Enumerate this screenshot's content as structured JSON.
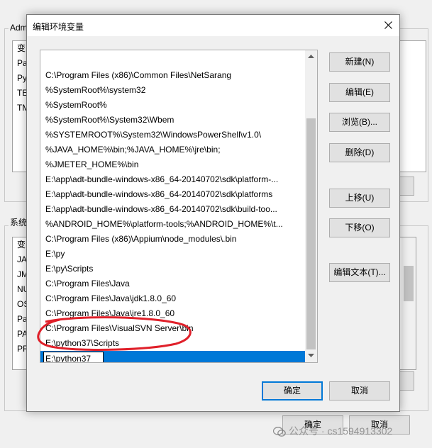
{
  "background_window": {
    "user_group_label": "Adm",
    "user_vars": [
      "变",
      "Pa",
      "Py",
      "TE",
      "TM"
    ],
    "system_group_label": "系统",
    "system_vars": [
      "变",
      "JA",
      "JM",
      "NU",
      "OS",
      "Pa",
      "PA",
      "PR"
    ],
    "ok_label": "确定",
    "cancel_label": "取消"
  },
  "dialog": {
    "title": "编辑环境变量",
    "entries": [
      "C:\\Program Files (x86)\\Common Files\\NetSarang",
      "%SystemRoot%\\system32",
      "%SystemRoot%",
      "%SystemRoot%\\System32\\Wbem",
      "%SYSTEMROOT%\\System32\\WindowsPowerShell\\v1.0\\",
      "%JAVA_HOME%\\bin;%JAVA_HOME%\\jre\\bin;",
      "%JMETER_HOME%\\bin",
      "E:\\app\\adt-bundle-windows-x86_64-20140702\\sdk\\platform-...",
      "E:\\app\\adt-bundle-windows-x86_64-20140702\\sdk\\platforms",
      "E:\\app\\adt-bundle-windows-x86_64-20140702\\sdk\\build-too...",
      "%ANDROID_HOME%\\platform-tools;%ANDROID_HOME%\\t...",
      "C:\\Program Files (x86)\\Appium\\node_modules\\.bin",
      "E:\\py",
      "E:\\py\\Scripts",
      "C:\\Program Files\\Java",
      "C:\\Program Files\\Java\\jdk1.8.0_60",
      "C:\\Program Files\\Java\\jre1.8.0_60",
      "C:\\Program Files\\VisualSVN Server\\bin",
      "E:\\python37\\Scripts"
    ],
    "editing_value": "E:\\python37",
    "buttons": {
      "new": "新建(N)",
      "edit": "编辑(E)",
      "browse": "浏览(B)...",
      "delete": "删除(D)",
      "move_up": "上移(U)",
      "move_down": "下移(O)",
      "edit_text": "编辑文本(T)...",
      "ok": "确定",
      "cancel": "取消"
    }
  },
  "watermark": "公众号 · cs1594913302",
  "colors": {
    "selection": "#0078d7",
    "annotation": "#e0202a"
  }
}
